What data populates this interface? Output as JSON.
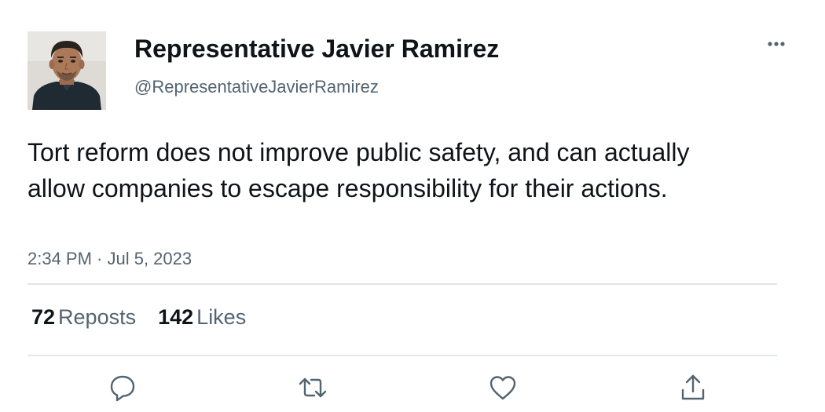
{
  "tweet": {
    "author": {
      "display_name": "Representative Javier Ramirez",
      "handle": "@RepresentativeJavierRamirez"
    },
    "text": "Tort reform does not improve public safety, and can actually allow companies to escape responsibility for their actions.",
    "timestamp": "2:34 PM · Jul 5, 2023",
    "stats": {
      "reposts_count": "72",
      "reposts_label": "Reposts",
      "likes_count": "142",
      "likes_label": "Likes"
    },
    "icons": {
      "more": "more-horizontal-icon",
      "reply": "reply-icon",
      "repost": "repost-icon",
      "like": "heart-icon",
      "share": "share-icon"
    }
  },
  "colors": {
    "text_primary": "#0f1419",
    "text_secondary": "#536471",
    "divider": "#e1e6ea"
  }
}
